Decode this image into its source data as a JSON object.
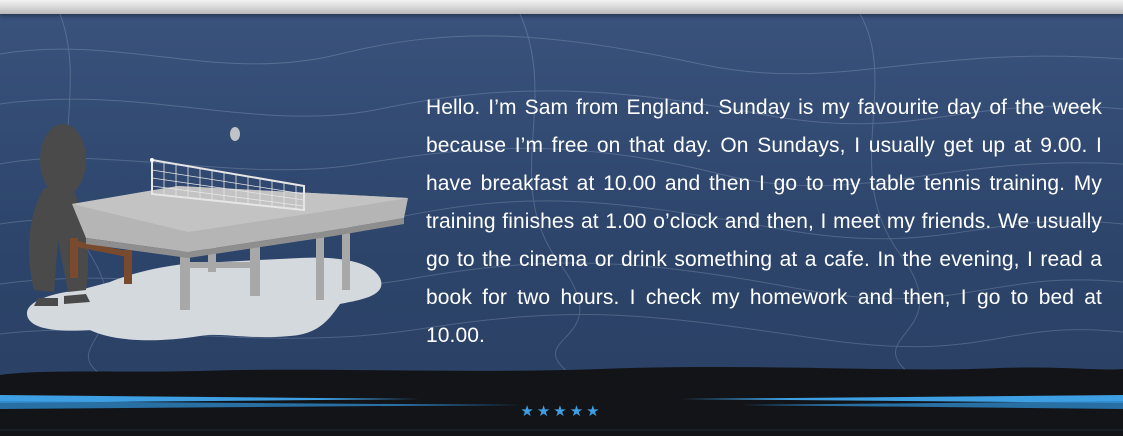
{
  "story": {
    "paragraph": "Hello. I’m Sam from England. Sunday is my favourite day of the week because I’m free on that day. On Sundays, I usually get up at 9.00. I have breakfast at 10.00 and then I go to my table tennis training. My training finishes at 1.00 o’clock and then, I meet my friends. We usually go to the cinema or drink something at a cafe. In the evening, I read a book for two hours. I check my homework and then, I go to bed at 10.00."
  },
  "footer": {
    "stars": "★★★★★"
  },
  "colors": {
    "background": "#2d456b",
    "footer": "#121418",
    "accent": "#3ea0e3",
    "text": "#ffffff"
  },
  "illustration": {
    "icon": "table-tennis-player-icon"
  }
}
